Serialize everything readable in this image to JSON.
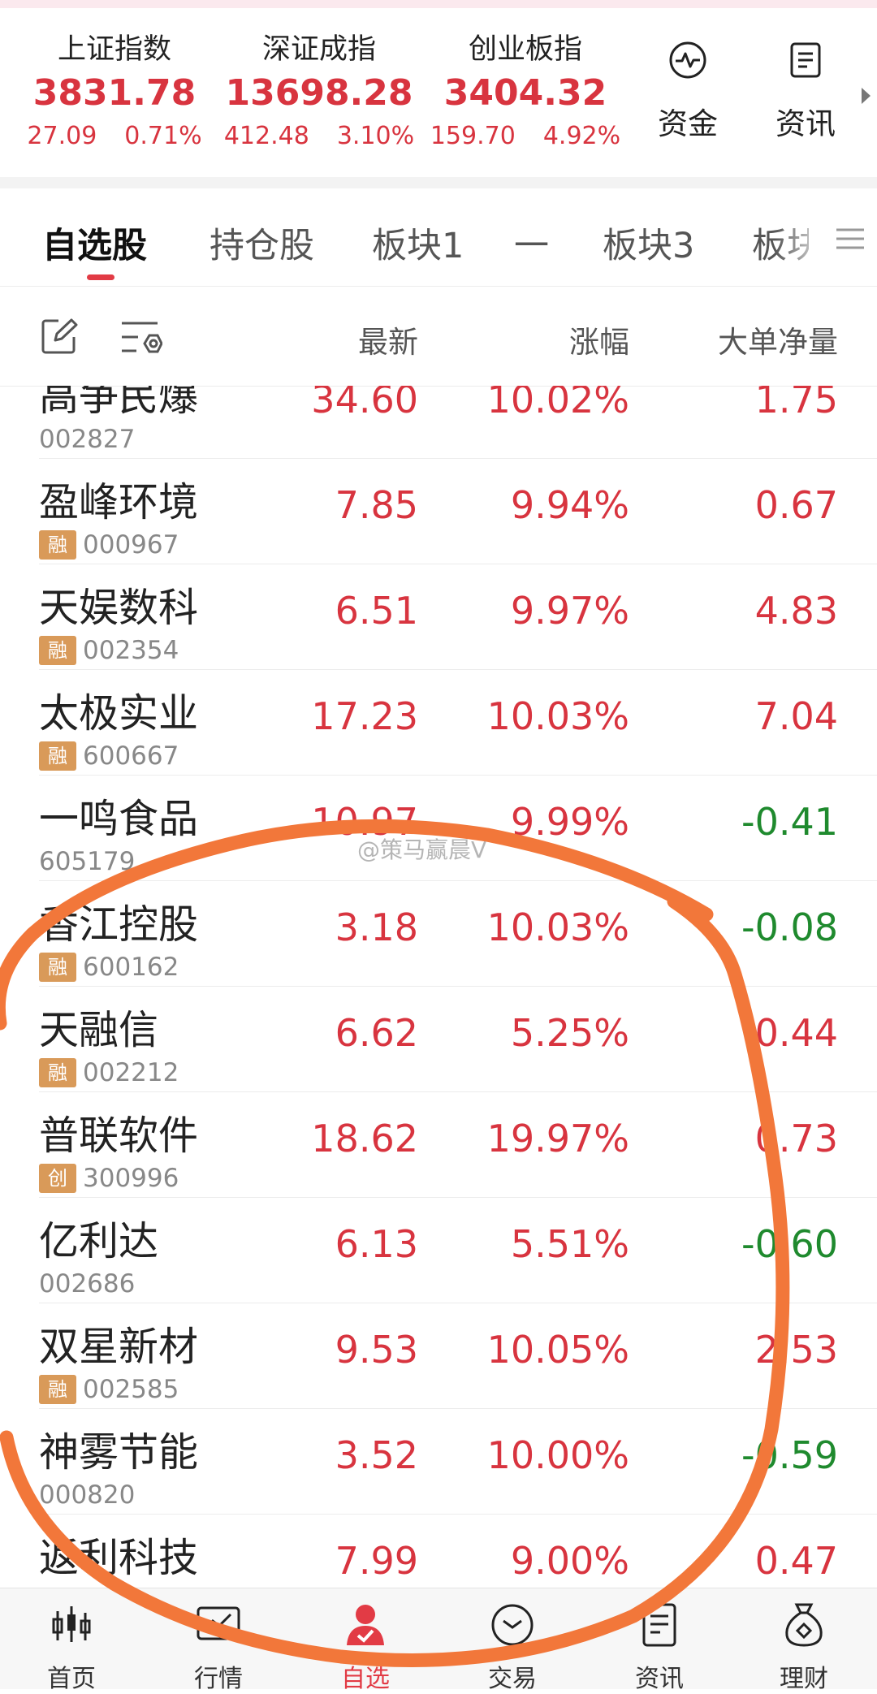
{
  "indices": [
    {
      "name": "上证指数",
      "value": "3831.78",
      "change": "27.09",
      "pct": "0.71%"
    },
    {
      "name": "深证成指",
      "value": "13698.28",
      "change": "412.48",
      "pct": "3.10%"
    },
    {
      "name": "创业板指",
      "value": "3404.32",
      "change": "159.70",
      "pct": "4.92%"
    }
  ],
  "tools": {
    "funds_label": "资金",
    "news_label": "资讯"
  },
  "tabs": [
    "自选股",
    "持仓股",
    "板块1",
    "一",
    "板块3",
    "板块"
  ],
  "columns": {
    "latest": "最新",
    "change_pct": "涨幅",
    "big_order": "大单净量"
  },
  "stocks": [
    {
      "name": "高争民爆",
      "code": "002827",
      "badge": "",
      "price": "34.60",
      "pct": "10.02%",
      "big": "1.75",
      "big_color": "red"
    },
    {
      "name": "盈峰环境",
      "code": "000967",
      "badge": "融",
      "price": "7.85",
      "pct": "9.94%",
      "big": "0.67",
      "big_color": "red"
    },
    {
      "name": "天娱数科",
      "code": "002354",
      "badge": "融",
      "price": "6.51",
      "pct": "9.97%",
      "big": "4.83",
      "big_color": "red"
    },
    {
      "name": "太极实业",
      "code": "600667",
      "badge": "融",
      "price": "17.23",
      "pct": "10.03%",
      "big": "7.04",
      "big_color": "red"
    },
    {
      "name": "一鸣食品",
      "code": "605179",
      "badge": "",
      "price": "10.97",
      "pct": "9.99%",
      "big": "-0.41",
      "big_color": "green"
    },
    {
      "name": "香江控股",
      "code": "600162",
      "badge": "融",
      "price": "3.18",
      "pct": "10.03%",
      "big": "-0.08",
      "big_color": "green"
    },
    {
      "name": "天融信",
      "code": "002212",
      "badge": "融",
      "price": "6.62",
      "pct": "5.25%",
      "big": "0.44",
      "big_color": "red"
    },
    {
      "name": "普联软件",
      "code": "300996",
      "badge": "创",
      "price": "18.62",
      "pct": "19.97%",
      "big": "0.73",
      "big_color": "red"
    },
    {
      "name": "亿利达",
      "code": "002686",
      "badge": "",
      "price": "6.13",
      "pct": "5.51%",
      "big": "-0.60",
      "big_color": "green"
    },
    {
      "name": "双星新材",
      "code": "002585",
      "badge": "融",
      "price": "9.53",
      "pct": "10.05%",
      "big": "2.53",
      "big_color": "red"
    },
    {
      "name": "神雾节能",
      "code": "000820",
      "badge": "",
      "price": "3.52",
      "pct": "10.00%",
      "big": "-0.59",
      "big_color": "green"
    },
    {
      "name": "返利科技",
      "code": "",
      "badge": "",
      "price": "7.99",
      "pct": "9.00%",
      "big": "0.47",
      "big_color": "red"
    }
  ],
  "nav": [
    "首页",
    "行情",
    "自选",
    "交易",
    "资讯",
    "理财"
  ],
  "watermark": "@策马赢晨V",
  "colors": {
    "up": "#d8343f",
    "down": "#1f8a2e",
    "accent": "#e23b45",
    "scribble": "#f2773a"
  }
}
